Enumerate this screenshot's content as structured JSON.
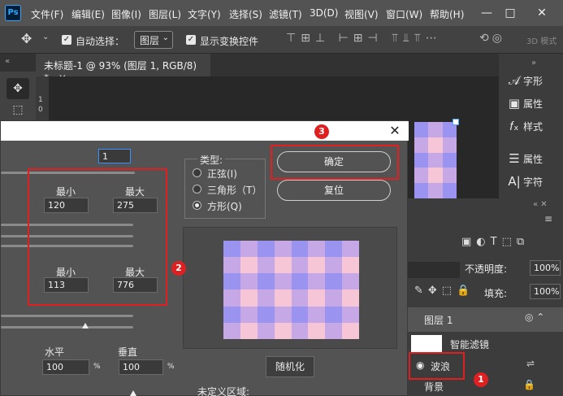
{
  "menubar": {
    "logo": "Ps",
    "items": [
      "文件(F)",
      "编辑(E)",
      "图像(I)",
      "图层(L)",
      "文字(Y)",
      "选择(S)",
      "滤镜(T)",
      "3D(D)",
      "视图(V)",
      "窗口(W)",
      "帮助(H)"
    ],
    "minimize": "—",
    "restore": "□",
    "close": "✕"
  },
  "options": {
    "auto_select_label": "自动选择：",
    "auto_select_target": "图层",
    "show_transform_label": "显示变换控件",
    "mode_3d": "3D 模式"
  },
  "document": {
    "tab_title": "未标题-1 @ 93% (图层 1, RGB/8) *",
    "ruler_marks": [
      "1",
      "0"
    ]
  },
  "right_panel": {
    "items": [
      {
        "icon": "character-icon",
        "label": "字形"
      },
      {
        "icon": "properties-icon",
        "label": "属性"
      },
      {
        "icon": "styles-icon",
        "label": "样式"
      },
      {
        "icon": "adjust-icon",
        "label": "属性"
      },
      {
        "icon": "text-icon",
        "label": "字符"
      }
    ]
  },
  "layers": {
    "opacity_label": "不透明度:",
    "opacity_value": "100%",
    "fill_label": "填充:",
    "fill_value": "100%",
    "layer1_name": "图层 1",
    "smart_filter": "智能滤镜",
    "wave_filter": "波浪",
    "background": "背景"
  },
  "dialog": {
    "top_field": "1",
    "min_label_1": "最小",
    "max_label_1": "最大",
    "wavelength_min": "120",
    "wavelength_max": "275",
    "min_label_2": "最小",
    "max_label_2": "最大",
    "amplitude_min": "113",
    "amplitude_max": "776",
    "horizontal_label": "水平",
    "vertical_label": "垂直",
    "horizontal_value": "100",
    "vertical_value": "100",
    "percent": "%",
    "type_label": "类型:",
    "type_options": [
      "正弦(I)",
      "三角形（T）",
      "方形(Q)"
    ],
    "type_selected": 2,
    "ok_button": "确定",
    "reset_button": "复位",
    "randomize_button": "随机化",
    "undefined_area_label": "未定义区域:"
  },
  "annotations": {
    "badge1": "1",
    "badge2": "2",
    "badge3": "3"
  },
  "colors": {
    "preview_purple": "#9a93ef",
    "preview_pink": "#f7c6d6",
    "preview_mauve": "#c6a8e6",
    "annotation_red": "#e02020"
  }
}
